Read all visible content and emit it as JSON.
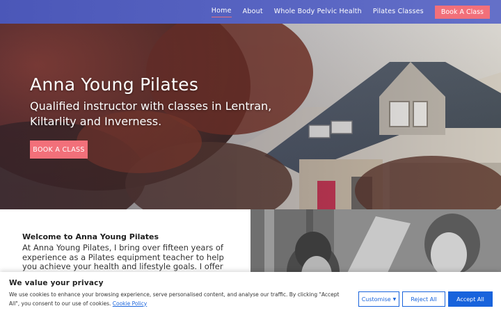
{
  "header": {
    "nav": [
      {
        "label": "Home",
        "active": true
      },
      {
        "label": "About",
        "active": false
      },
      {
        "label": "Whole Body Pelvic Health",
        "active": false
      },
      {
        "label": "Pilates Classes",
        "active": false
      }
    ],
    "book_label": "Book A Class"
  },
  "hero": {
    "title": "Anna Young Pilates",
    "subtitle": "Qualified instructor with classes in Lentran, Kiltarlity and Inverness.",
    "button_label": "BOOK A CLASS"
  },
  "welcome": {
    "title": "Welcome to Anna Young Pilates",
    "text": "At Anna Young Pilates, I bring over fifteen years of experience as a Pilates equipment teacher to help you achieve your health and lifestyle goals. I offer a variety of"
  },
  "cookie": {
    "title": "We value your privacy",
    "text": "We use cookies to enhance your browsing experience, serve personalised content, and analyse our traffic. By clicking \"Accept All\", you consent to our use of cookies.",
    "link_label": "Cookie Policy",
    "customise_label": "Customise",
    "reject_label": "Reject All",
    "accept_label": "Accept All"
  },
  "colors": {
    "header": "#5561be",
    "accent": "#f2707a",
    "cookie_blue": "#1863dc"
  },
  "icons": {
    "customise_caret": "caret-down-icon"
  }
}
